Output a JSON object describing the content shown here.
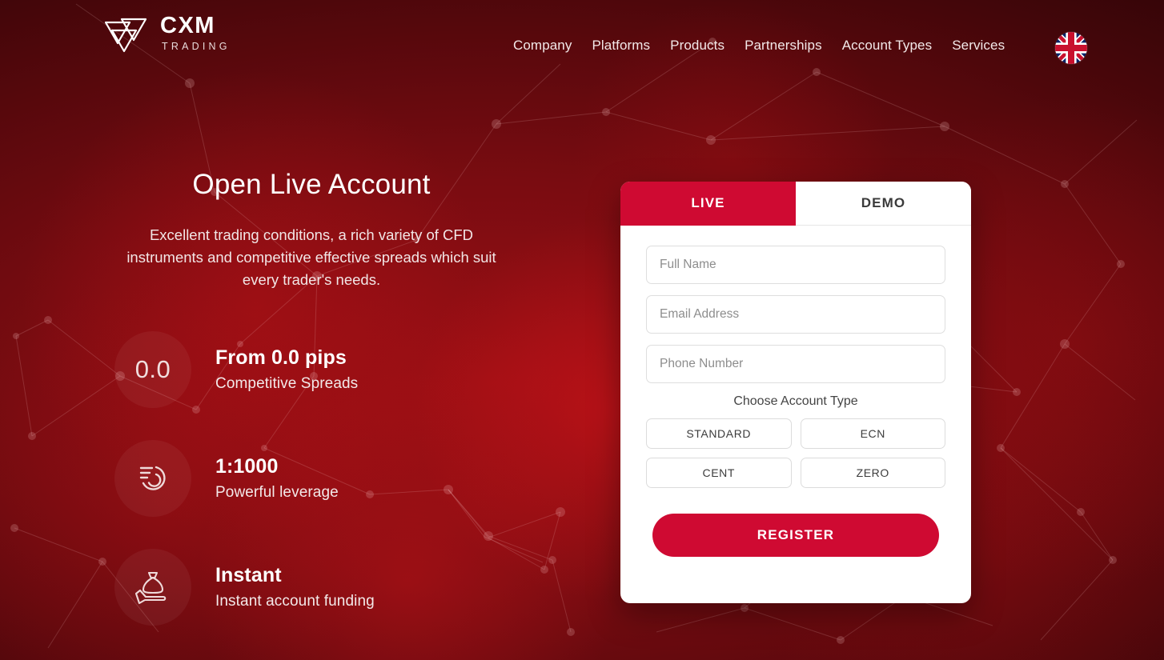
{
  "brand": {
    "name": "CXM",
    "tagline": "TRADING",
    "accent_color": "#CF0A32",
    "logo_icon": "cxm-triangles-logo-icon"
  },
  "nav": {
    "items": [
      {
        "label": "Company"
      },
      {
        "label": "Platforms"
      },
      {
        "label": "Products"
      },
      {
        "label": "Partnerships"
      },
      {
        "label": "Account Types"
      },
      {
        "label": "Services"
      }
    ],
    "language_flag": "united-kingdom-flag-icon"
  },
  "hero": {
    "title": "Open Live Account",
    "subtitle": "Excellent trading conditions, a rich variety of CFD instruments and competitive effective spreads which suit every trader's needs."
  },
  "features": [
    {
      "icon": "zero-pips-text-icon",
      "icon_text": "0.0",
      "title": "From 0.0 pips",
      "desc": "Competitive Spreads"
    },
    {
      "icon": "speed-gauge-icon",
      "icon_text": "",
      "title": "1:1000",
      "desc": "Powerful leverage"
    },
    {
      "icon": "hand-money-bag-icon",
      "icon_text": "",
      "title": "Instant",
      "desc": "Instant account funding"
    }
  ],
  "form": {
    "tabs": [
      {
        "label": "LIVE",
        "active": true
      },
      {
        "label": "DEMO",
        "active": false
      }
    ],
    "fields": [
      {
        "name": "full-name",
        "placeholder": "Full Name",
        "value": ""
      },
      {
        "name": "email",
        "placeholder": "Email Address",
        "value": ""
      },
      {
        "name": "phone",
        "placeholder": "Phone Number",
        "value": ""
      }
    ],
    "account_type_label": "Choose Account Type",
    "account_types": [
      {
        "label": "STANDARD"
      },
      {
        "label": "ECN"
      },
      {
        "label": "CENT"
      },
      {
        "label": "ZERO"
      }
    ],
    "submit_label": "REGISTER"
  }
}
